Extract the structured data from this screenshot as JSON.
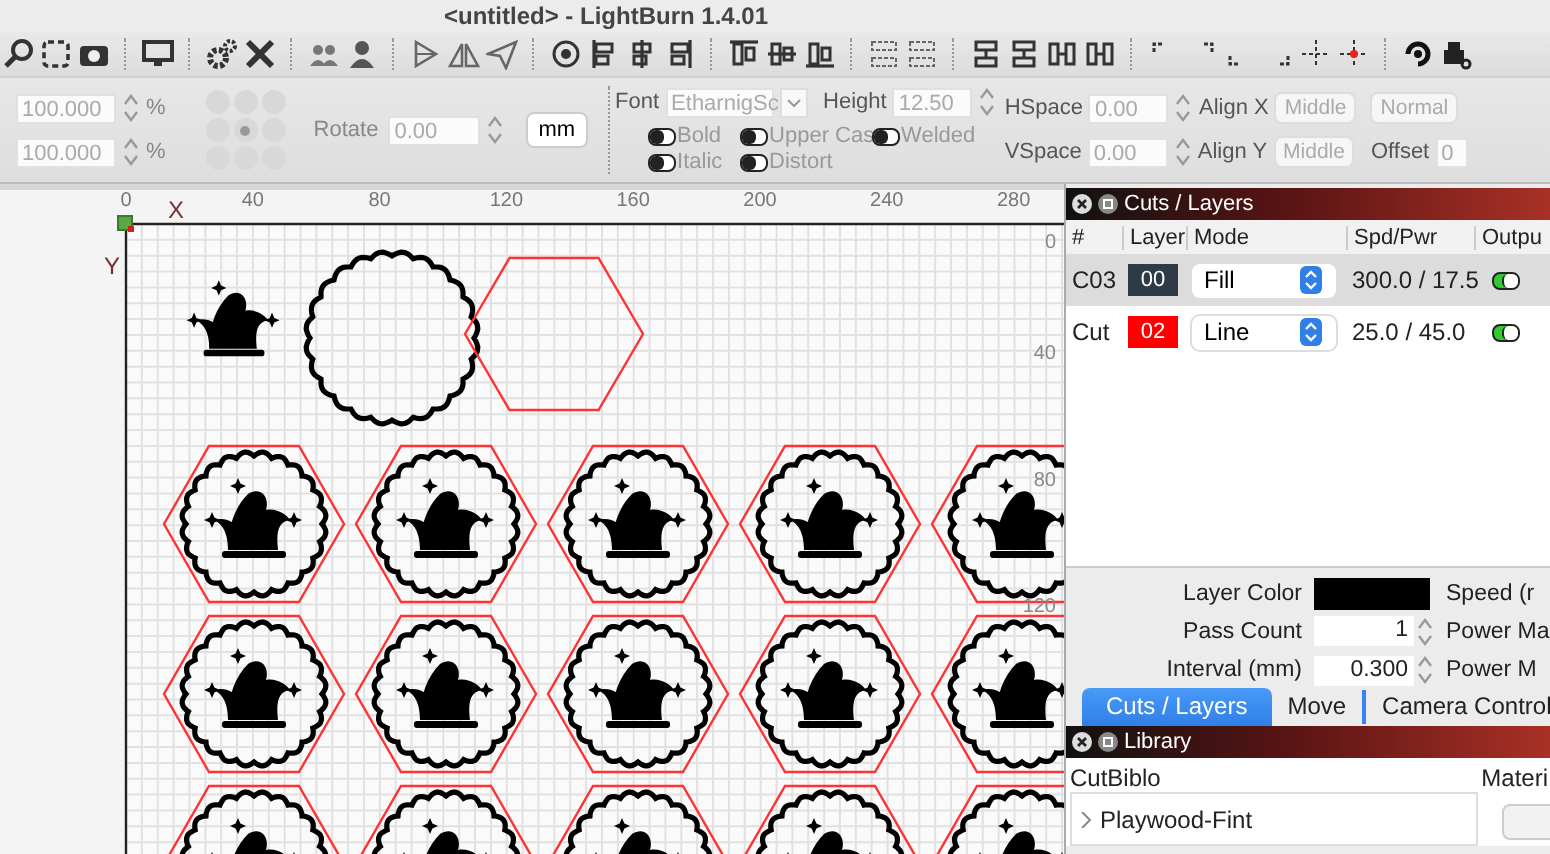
{
  "window": {
    "title": "<untitled> - LightBurn 1.4.01"
  },
  "options": {
    "disabled": true,
    "scale_fields": [
      {
        "value": "100.000",
        "unit": "%"
      },
      {
        "value": "100.000",
        "unit": "%"
      }
    ],
    "anchor_points": [
      {
        "selected": false
      },
      {
        "selected": false
      },
      {
        "selected": false
      },
      {
        "selected": false
      },
      {
        "selected": true
      },
      {
        "selected": false
      },
      {
        "selected": false
      },
      {
        "selected": false
      },
      {
        "selected": false
      }
    ],
    "rotate": {
      "label": "Rotate",
      "value": "0.00"
    },
    "units_button": "mm",
    "font": {
      "label": "Font",
      "value": "EtharnigSc"
    },
    "height": {
      "label": "Height",
      "value": "12.50"
    },
    "toggles": [
      {
        "label": "Bold",
        "on": false
      },
      {
        "label": "Upper Cas",
        "on": false
      },
      {
        "label": "Welded",
        "on": false
      },
      {
        "label": "Italic",
        "on": false
      },
      {
        "label": "Distort",
        "on": false
      }
    ],
    "hspace": {
      "label": "HSpace",
      "value": "0.00"
    },
    "align_x": {
      "label": "Align X",
      "value": "Middle"
    },
    "style_dropdown": "Normal",
    "vspace": {
      "label": "VSpace",
      "value": "0.00"
    },
    "align_y": {
      "label": "Align Y",
      "value": "Middle"
    },
    "offset": {
      "label": "Offset",
      "value": "0"
    }
  },
  "canvas": {
    "x_axis": "X",
    "y_axis": "Y",
    "top_ruler": [
      "0",
      "40",
      "80",
      "120",
      "160",
      "200",
      "240",
      "280"
    ],
    "side_ruler": [
      "0",
      "40",
      "80",
      "120"
    ]
  },
  "cuts_panel": {
    "title": "Cuts / Layers",
    "columns": [
      "#",
      "Layer",
      "Mode",
      "Spd/Pwr",
      "Outpu"
    ],
    "rows": [
      {
        "name": "C03",
        "layer": "00",
        "color": "#2e3a46",
        "mode": "Fill",
        "spd_pwr": "300.0 / 17.5",
        "output": true,
        "selected": true
      },
      {
        "name": "Cut",
        "layer": "02",
        "color": "#ff0000",
        "mode": "Line",
        "spd_pwr": "25.0 / 45.0",
        "output": true,
        "selected": false
      }
    ],
    "settings": [
      {
        "label": "Layer Color",
        "kind": "swatch",
        "side_label": "Speed (r"
      },
      {
        "label": "Pass Count",
        "kind": "spin",
        "value": "1",
        "side_label": "Power Ma"
      },
      {
        "label": "Interval (mm)",
        "kind": "spin",
        "value": "0.300",
        "side_label": "Power M"
      }
    ]
  },
  "tabs": [
    {
      "label": "Cuts / Layers",
      "selected": true
    },
    {
      "label": "Move",
      "selected": false
    },
    {
      "label": "Camera Control",
      "selected": false
    }
  ],
  "library": {
    "title": "Library",
    "list_label": "CutBiblo",
    "side_label": "Materi",
    "items": [
      {
        "label": "Playwood-Fint",
        "expanded": false
      }
    ]
  }
}
